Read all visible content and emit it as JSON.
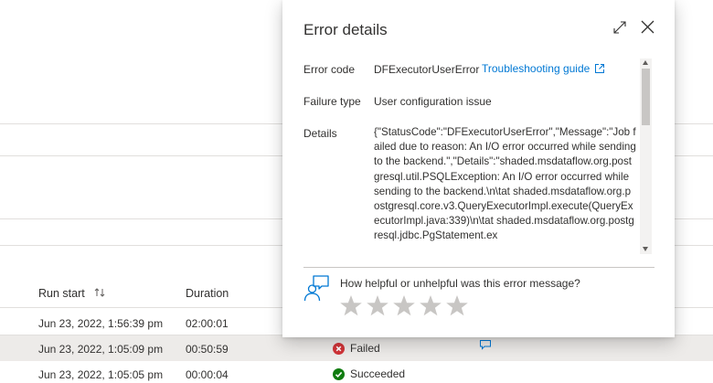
{
  "table": {
    "headers": {
      "run_start": "Run start",
      "duration": "Duration"
    },
    "rows": [
      {
        "run_start": "Jun 23, 2022, 1:56:39 pm",
        "duration": "02:00:01",
        "status": ""
      },
      {
        "run_start": "Jun 23, 2022, 1:05:09 pm",
        "duration": "00:50:59",
        "status": "Failed"
      },
      {
        "run_start": "Jun 23, 2022, 1:05:05 pm",
        "duration": "00:00:04",
        "status": "Succeeded"
      }
    ]
  },
  "panel": {
    "title": "Error details",
    "error_code_label": "Error code",
    "error_code_value": "DFExecutorUserError",
    "troubleshooting_link": "Troubleshooting guide",
    "failure_type_label": "Failure type",
    "failure_type_value": "User configuration issue",
    "details_label": "Details",
    "details_value": "{\"StatusCode\":\"DFExecutorUserError\",\"Message\":\"Job failed due to reason: An I/O error occurred while sending to the backend.\",\"Details\":\"shaded.msdataflow.org.postgresql.util.PSQLException: An I/O error occurred while sending to the backend.\\n\\tat shaded.msdataflow.org.postgresql.core.v3.QueryExecutorImpl.execute(QueryExecutorImpl.java:339)\\n\\tat shaded.msdataflow.org.postgresql.jdbc.PgStatement.ex",
    "feedback_question": "How helpful or unhelpful was this error message?",
    "rating": {
      "value": 0,
      "max": 5
    }
  },
  "colors": {
    "accent": "#0078d4",
    "failed": "#d13438",
    "succeeded": "#107c10",
    "selected_row": "#edebe9"
  },
  "icons": {
    "sort": "sort-updown-icon",
    "expand": "expand-icon",
    "close": "close-icon",
    "external": "external-link-icon",
    "feedback": "feedback-person-icon",
    "star": "star-icon",
    "failed": "error-circle-icon",
    "succeeded": "check-circle-icon",
    "comment": "comment-icon"
  }
}
